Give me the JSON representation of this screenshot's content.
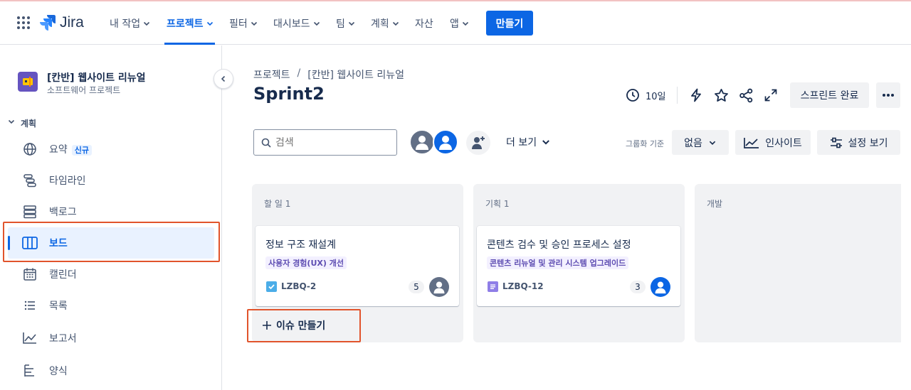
{
  "app": {
    "name": "Jira"
  },
  "nav": {
    "my_work": "내 작업",
    "projects": "프로젝트",
    "filters": "필터",
    "dashboards": "대시보드",
    "teams": "팀",
    "plans": "계획",
    "assets": "자산",
    "apps": "앱",
    "create": "만들기"
  },
  "sidebar": {
    "project_name": "[칸반] 웹사이트 리뉴얼",
    "project_type": "소프트웨어 프로젝트",
    "section": "계획",
    "items": [
      {
        "label": "요약",
        "badge": "신규"
      },
      {
        "label": "타임라인"
      },
      {
        "label": "백로그"
      },
      {
        "label": "보드"
      },
      {
        "label": "캘린더"
      },
      {
        "label": "목록"
      },
      {
        "label": "보고서"
      },
      {
        "label": "양식"
      }
    ]
  },
  "header": {
    "breadcrumb_root": "프로젝트",
    "breadcrumb_sep": "/",
    "breadcrumb_project": "[칸반] 웹사이트 리뉴얼",
    "title": "Sprint2",
    "days_left": "10일",
    "complete_sprint": "스프린트 완료"
  },
  "toolbar": {
    "search_placeholder": "검색",
    "more": "더 보기",
    "group_by_label": "그룹화 기준",
    "group_by_value": "없음",
    "insights": "인사이트",
    "view_settings": "설정 보기"
  },
  "board": {
    "columns": [
      {
        "title": "할 일 1",
        "cards": [
          {
            "title": "정보 구조 재설계",
            "label": "사용자 경험(UX) 개선",
            "key": "LZBQ-2",
            "estimate": "5",
            "type": "task"
          }
        ]
      },
      {
        "title": "기획 1",
        "cards": [
          {
            "title": "콘텐츠 검수 및 승인 프로세스 설정",
            "label": "콘텐츠 리뉴얼 및 관리 시스템 업그레이드",
            "key": "LZBQ-12",
            "estimate": "3",
            "type": "story"
          }
        ]
      },
      {
        "title": "개발",
        "cards": []
      }
    ],
    "create_issue": "이슈 만들기"
  },
  "colors": {
    "brand_blue": "#0c66e4",
    "highlight_red": "#e1542c",
    "task_blue": "#4bade8",
    "story_purple": "#8f7ee7",
    "label_purple": "#5e4db2"
  }
}
